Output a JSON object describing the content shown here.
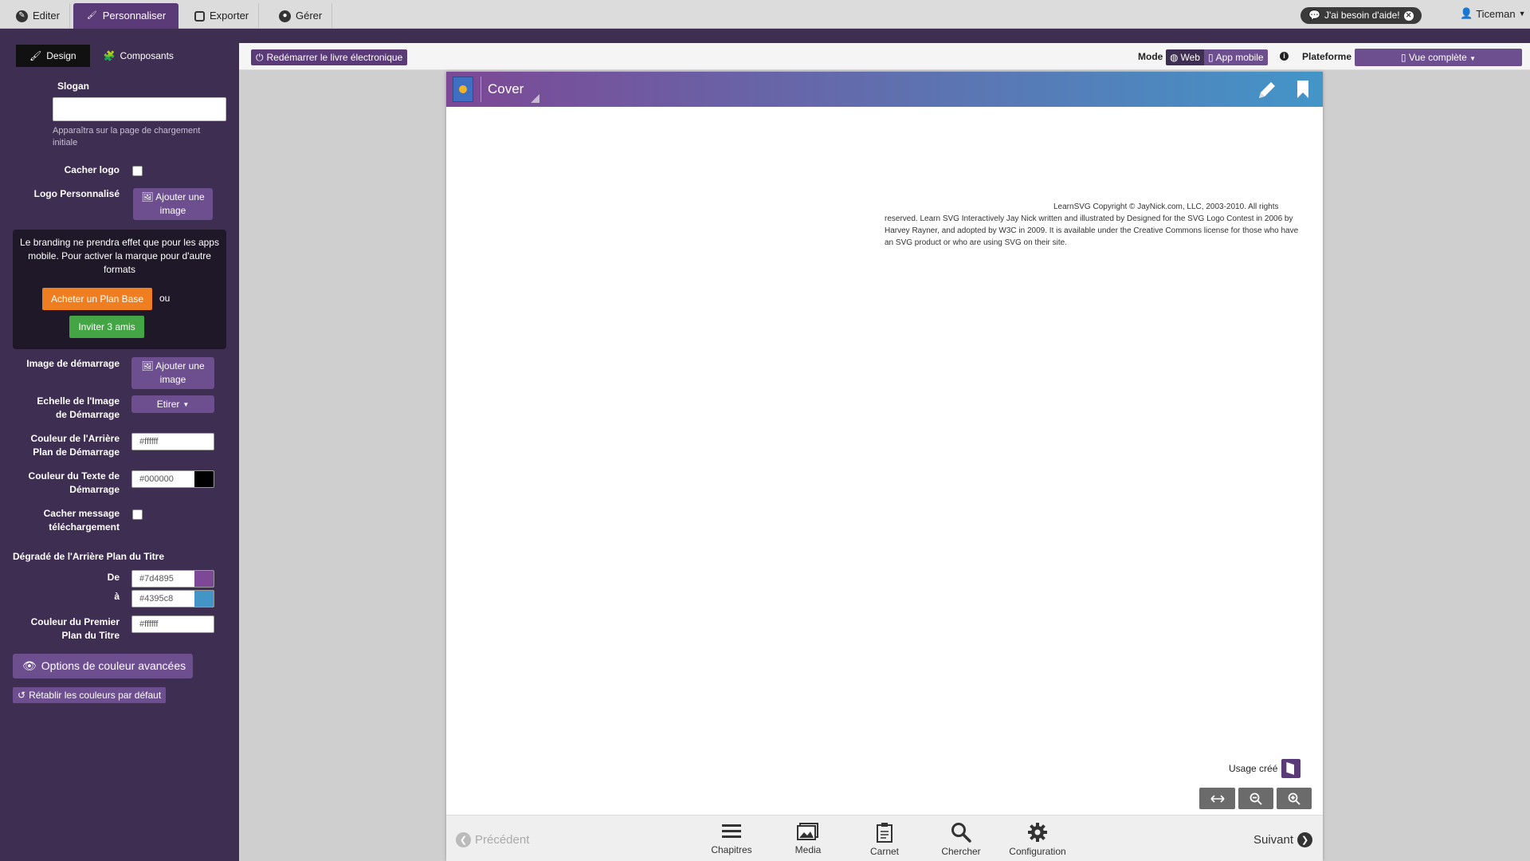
{
  "topnav": {
    "tabs": [
      {
        "label": "Editer",
        "icon": "pencil-icon"
      },
      {
        "label": "Personnaliser",
        "icon": "brush-icon"
      },
      {
        "label": "Exporter",
        "icon": "export-icon"
      },
      {
        "label": "Gérer",
        "icon": "user-icon"
      }
    ],
    "help_label": "J'ai besoin d'aide!",
    "user_name": "Ticeman"
  },
  "sidebar": {
    "subtabs": [
      {
        "label": "Design",
        "icon": "brush-icon"
      },
      {
        "label": "Composants",
        "icon": "puzzle-icon"
      }
    ],
    "slogan_label": "Slogan",
    "slogan_value": "",
    "slogan_hint": "Apparaîtra sur la page de chargement initiale",
    "hide_logo_label": "Cacher logo",
    "custom_logo_label": "Logo Personnalisé",
    "add_image_label": "Ajouter une image",
    "branding_notice": "Le branding ne prendra effet que pour les apps mobile. Pour activer la marque pour d'autre formats",
    "buy_plan_label": "Acheter un Plan Base",
    "or_label": "ou",
    "invite_label": "Inviter 3 amis",
    "startup_image_label": "Image de démarrage",
    "startup_scale_label": "Echelle de l'Image de Démarrage",
    "startup_scale_value": "Etirer",
    "startup_bg_label": "Couleur de l'Arrière Plan de Démarrage",
    "startup_bg_value": "#ffffff",
    "startup_text_label": "Couleur du Texte de Démarrage",
    "startup_text_value": "#000000",
    "hide_download_label": "Cacher message téléchargement",
    "gradient_heading": "Dégradé de l'Arrière Plan du Titre",
    "from_label": "De",
    "to_label": "à",
    "from_value": "#7d4895",
    "to_value": "#4395c8",
    "title_fg_label": "Couleur du Premier Plan du Titre",
    "title_fg_value": "#ffffff",
    "advanced_label": "Options de couleur avancées",
    "reset_label": "Rétablir les couleurs par défaut"
  },
  "toolbar": {
    "restart_label": "Redémarrer le livre électronique",
    "mode_label": "Mode",
    "mode_web": "Web",
    "mode_app": "App mobile",
    "platform_label": "Plateforme",
    "platform_value": "Vue complète"
  },
  "book": {
    "title": "Cover",
    "copyright": "LearnSVG Copyright © JayNick.com, LLC, 2003-2010. All rights reserved. Learn SVG Interactively Jay Nick written and illustrated by Designed for the SVG Logo Contest in 2006 by Harvey Rayner, and adopted by W3C in 2009. It is available under the Creative Commons license for those who have an SVG product or who are using SVG on their site.",
    "usage_label": "Usage créé",
    "prev_label": "Précédent",
    "next_label": "Suivant",
    "nav_items": [
      {
        "label": "Chapitres",
        "icon": "menu-icon"
      },
      {
        "label": "Media",
        "icon": "image-icon"
      },
      {
        "label": "Carnet",
        "icon": "clipboard-icon"
      },
      {
        "label": "Chercher",
        "icon": "search-icon"
      },
      {
        "label": "Configuration",
        "icon": "gear-icon"
      }
    ]
  },
  "colors": {
    "accent": "#6d4e8f",
    "sidebar_bg": "#3e2e52",
    "gradient_from": "#7d4895",
    "gradient_to": "#4395c8",
    "buy_button": "#ee7e1f",
    "invite_button": "#43a544"
  }
}
